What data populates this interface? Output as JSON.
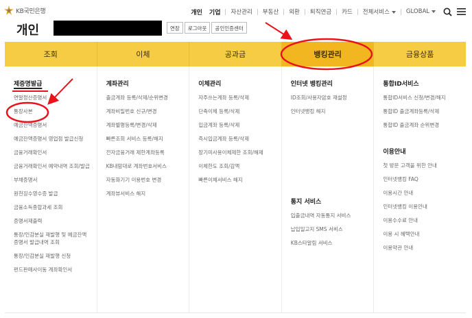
{
  "header": {
    "brand_name": "KB국민은행",
    "page_title": "개인",
    "nav": [
      {
        "label": "개인",
        "strong": true
      },
      {
        "label": "기업",
        "strong": true
      },
      {
        "label": "자산관리"
      },
      {
        "label": "부동산"
      },
      {
        "label": "외환"
      },
      {
        "label": "퇴직연금"
      },
      {
        "label": "카드"
      },
      {
        "label": "전체서비스",
        "caret": true
      },
      {
        "label": "GLOBAL",
        "caret": true
      }
    ],
    "search_icon": "search-icon",
    "menu_icon": "hamburger-menu-icon",
    "title_buttons": [
      "연장",
      "로그아웃",
      "공인인증센터"
    ]
  },
  "main_nav": {
    "tabs": [
      "조회",
      "이체",
      "공과금",
      "뱅킹관리",
      "금융상품"
    ],
    "active_index": 3
  },
  "columns": [
    {
      "title": "제증명발급",
      "items": [
        "연말정산증명서",
        "통장사본",
        "예금잔액증명서",
        "예금잔액증명서 영업점 발급신청",
        "금융거래확인서",
        "금융거래확인서 예약내역 조회/발급",
        "부채증명서",
        "원천징수영수증 발급",
        "금융소득종합과세 조회",
        "증명서재출력",
        "통장/인감분실 재발행 및 예금잔액증명서 발급내역 조회",
        "통장/인감분실 재발행 신청",
        "펀드판매사이동 계좌확인서"
      ]
    },
    {
      "title": "계좌관리",
      "items": [
        "출금계좌 등록/삭제/순위변경",
        "계좌비밀번호 신규/변경",
        "계좌별명등록/변경/삭제",
        "빠른조회 서비스 등록/해지",
        "전자금융거래 제한계좌등록",
        "KB내맘대로 계좌번호서비스",
        "자동화기기 이용번호 변경",
        "계좌뷰서비스 해지"
      ]
    },
    {
      "title": "이체관리",
      "items": [
        "자주쓰는계좌 등록/삭제",
        "단축이체 등록/삭제",
        "입금계좌 등록/삭제",
        "즉시입금계좌 등록/삭제",
        "장기미사용이체제한 조회/해제",
        "이체한도 조회/감액",
        "빠른이체서비스 해지"
      ]
    },
    {
      "title": "인터넷 뱅킹관리",
      "items": [
        "ID조회/사용자암호 재설정",
        "인터넷뱅킹 해지"
      ],
      "group2_title": "통지 서비스",
      "group2_items": [
        "입출금내역 자동통지 서비스",
        "납입일고지 SMS 서비스",
        "KB스타알림 서비스"
      ]
    },
    {
      "title": "통합ID서비스",
      "items": [
        "통합ID서비스 신청/변경/해지",
        "통합ID 출금계좌등록/삭제",
        "통합ID 출금계좌 순위변경"
      ],
      "group2_title": "이용안내",
      "group2_items": [
        "첫 방문 고객을 위한 안내",
        "인터넷뱅킹 FAQ",
        "이용시간 안내",
        "인터넷뱅킹 이용안내",
        "이용수수료 안내",
        "이용 시 혜택안내",
        "이용약관 안내"
      ]
    }
  ],
  "annotation_color": "#e8141c",
  "accent_color": "#f7cc45"
}
